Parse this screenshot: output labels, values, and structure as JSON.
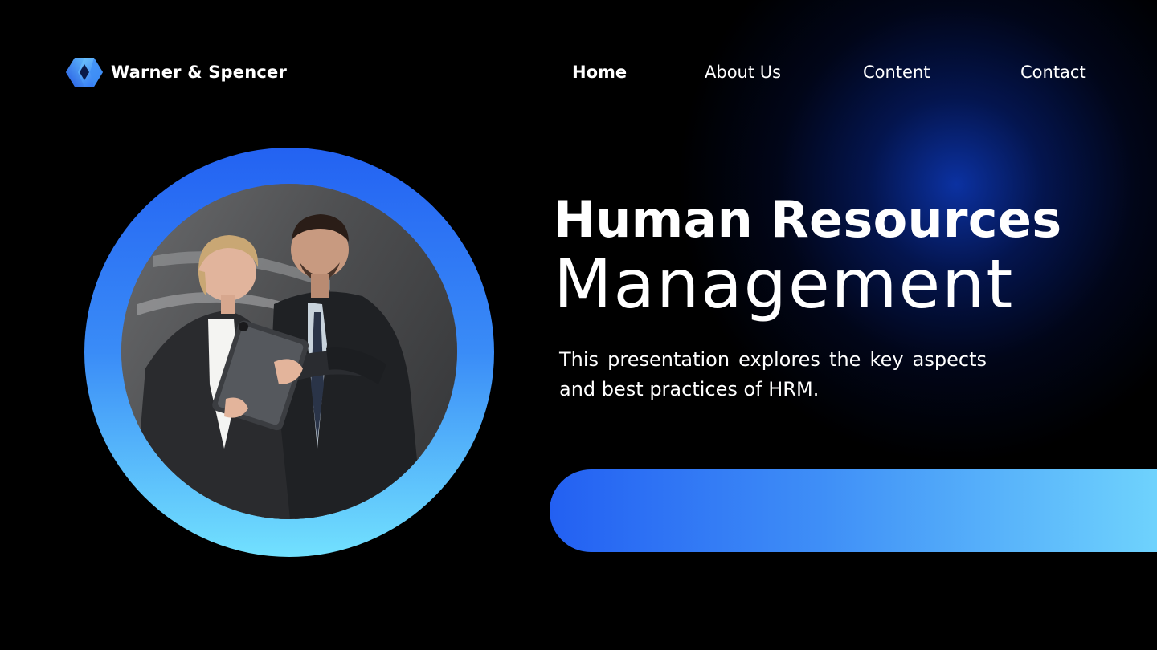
{
  "brand": {
    "name": "Warner & Spencer",
    "icon": "hexagon-logo-icon"
  },
  "nav": {
    "items": [
      {
        "label": "Home",
        "active": true
      },
      {
        "label": "About Us",
        "active": false
      },
      {
        "label": "Content",
        "active": false
      },
      {
        "label": "Contact",
        "active": false
      }
    ]
  },
  "hero": {
    "title_line1": "Human Resources",
    "title_line2": "Management",
    "description": "This presentation explores the key aspects and best practices of HRM."
  },
  "colors": {
    "background": "#000000",
    "accent_blue": "#2362f2",
    "accent_cyan": "#72e1fe",
    "glow": "#0c34aa"
  }
}
